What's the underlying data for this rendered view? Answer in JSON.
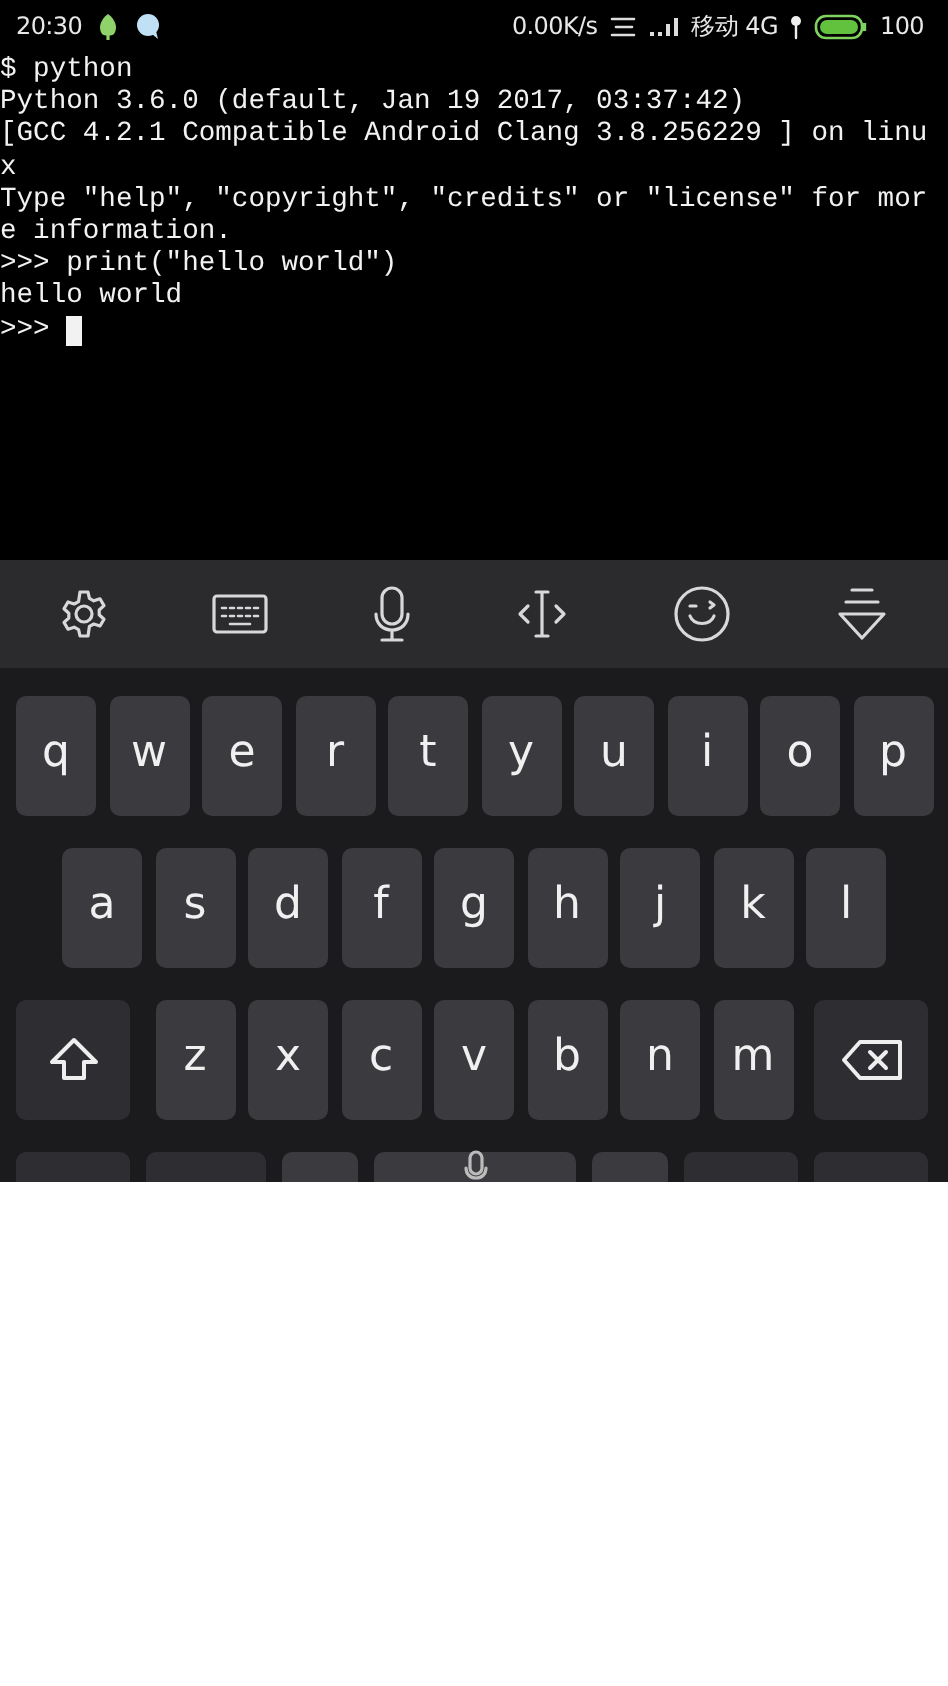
{
  "status_bar": {
    "time": "20:30",
    "speed": "0.00K/s",
    "carrier": "移动 4G",
    "battery": "100"
  },
  "terminal": {
    "lines": [
      "$ python",
      "Python 3.6.0 (default, Jan 19 2017, 03:37:42)",
      "[GCC 4.2.1 Compatible Android Clang 3.8.256229 ] on linu",
      "x",
      "Type \"help\", \"copyright\", \"credits\" or \"license\" for mor",
      "e information.",
      ">>> print(\"hello world\")",
      "hello world"
    ],
    "prompt": ">>>"
  },
  "keyboard_toolbar": [
    {
      "kind": "settings"
    },
    {
      "kind": "keyboard"
    },
    {
      "kind": "microphone"
    },
    {
      "kind": "cursor"
    },
    {
      "kind": "emoji"
    },
    {
      "kind": "collapse"
    }
  ],
  "keyboard_rows": [
    {
      "keys": [
        {
          "kind": "letter",
          "label": "q"
        },
        {
          "kind": "letter",
          "label": "w"
        },
        {
          "kind": "letter",
          "label": "e"
        },
        {
          "kind": "letter",
          "label": "r"
        },
        {
          "kind": "letter",
          "label": "t"
        },
        {
          "kind": "letter",
          "label": "y"
        },
        {
          "kind": "letter",
          "label": "u"
        },
        {
          "kind": "letter",
          "label": "i"
        },
        {
          "kind": "letter",
          "label": "o"
        },
        {
          "kind": "letter",
          "label": "p"
        }
      ]
    },
    {
      "keys": [
        {
          "kind": "letter",
          "label": "a"
        },
        {
          "kind": "letter",
          "label": "s"
        },
        {
          "kind": "letter",
          "label": "d"
        },
        {
          "kind": "letter",
          "label": "f"
        },
        {
          "kind": "letter",
          "label": "g"
        },
        {
          "kind": "letter",
          "label": "h"
        },
        {
          "kind": "letter",
          "label": "j"
        },
        {
          "kind": "letter",
          "label": "k"
        },
        {
          "kind": "letter",
          "label": "l"
        }
      ]
    },
    {
      "keys": [
        {
          "kind": "shift"
        },
        {
          "kind": "letter",
          "label": "z"
        },
        {
          "kind": "letter",
          "label": "x"
        },
        {
          "kind": "letter",
          "label": "c"
        },
        {
          "kind": "letter",
          "label": "v"
        },
        {
          "kind": "letter",
          "label": "b"
        },
        {
          "kind": "letter",
          "label": "n"
        },
        {
          "kind": "letter",
          "label": "m"
        },
        {
          "kind": "backspace"
        }
      ]
    },
    {
      "keys": [
        {
          "kind": "wide"
        },
        {
          "kind": "wide"
        },
        {
          "kind": "small"
        },
        {
          "kind": "space"
        },
        {
          "kind": "small"
        },
        {
          "kind": "wide"
        },
        {
          "kind": "wide"
        }
      ]
    }
  ]
}
